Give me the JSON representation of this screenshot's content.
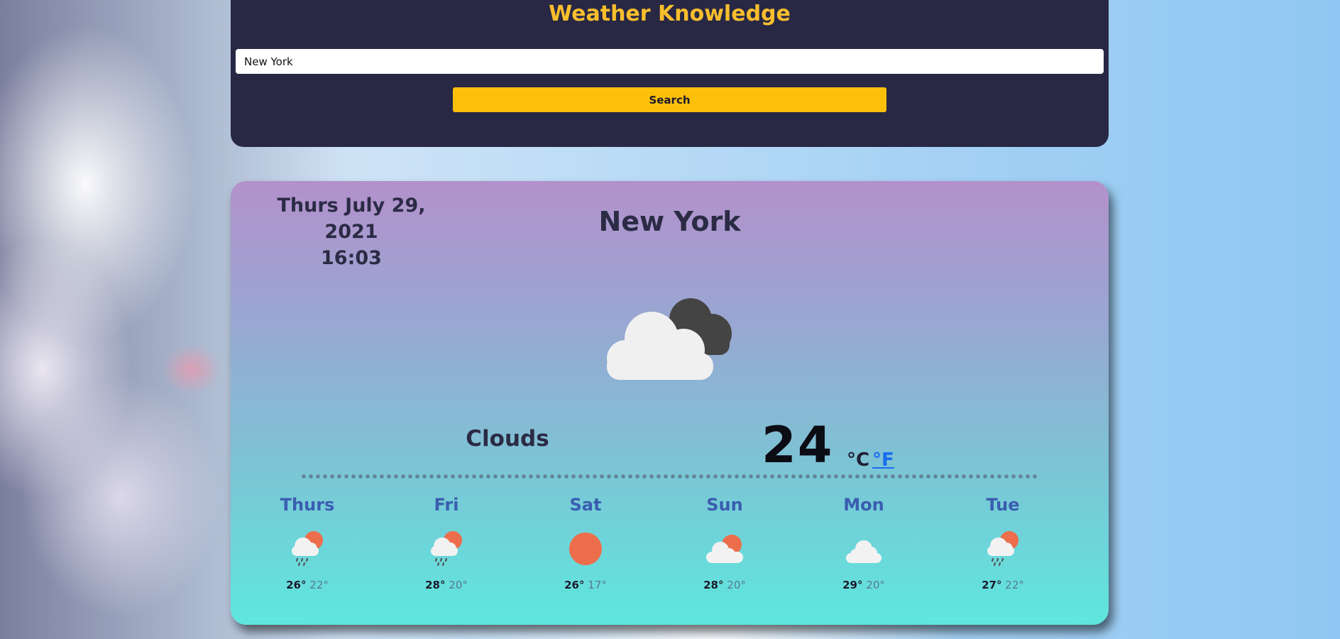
{
  "header": {
    "title": "Weather Knowledge",
    "search_value": "New York",
    "search_button": "Search"
  },
  "card": {
    "date": "Thurs July 29, 2021",
    "time": "16:03",
    "city": "New York",
    "main_icon": "clouds-icon",
    "description": "Clouds",
    "temperature": "24",
    "unit_celsius": "°C",
    "unit_fahrenheit": "°F"
  },
  "forecast": [
    {
      "day": "Thurs",
      "icon": "rain-sun-icon",
      "max": "26°",
      "min": "22°"
    },
    {
      "day": "Fri",
      "icon": "rain-sun-icon",
      "max": "28°",
      "min": "20°"
    },
    {
      "day": "Sat",
      "icon": "sun-icon",
      "max": "26°",
      "min": "17°"
    },
    {
      "day": "Sun",
      "icon": "cloud-sun-icon",
      "max": "28°",
      "min": "20°"
    },
    {
      "day": "Mon",
      "icon": "cloud-icon",
      "max": "29°",
      "min": "20°"
    },
    {
      "day": "Tue",
      "icon": "rain-sun-icon",
      "max": "27°",
      "min": "22°"
    }
  ],
  "colors": {
    "accent": "#f9be2c",
    "header_bg": "#282845",
    "button_bg": "#fcc00b",
    "link": "#1a6cf0",
    "sun": "#ec6e4c"
  }
}
